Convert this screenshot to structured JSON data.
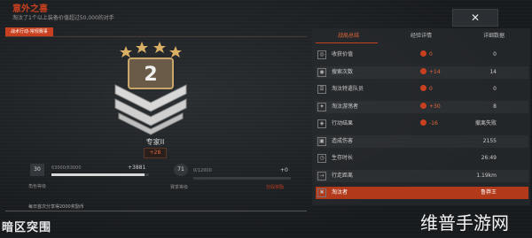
{
  "header": {
    "title": "意外之喜",
    "subtitle": "淘汰了1个以上装备价值超过50,000的对手",
    "topright": "",
    "back_label": "✕"
  },
  "tag": "战术行动-常规赛事",
  "rank": {
    "name": "专家II",
    "bonus": "+28",
    "emblem_number": "2",
    "stars": 4
  },
  "progress": {
    "left": {
      "level": "30",
      "exp": "63000/63000",
      "gain": "+3881",
      "label": "角色等级",
      "fill": 0.95
    },
    "right": {
      "level": "71",
      "exp": "0/12000",
      "gain": "+0",
      "label": "赛季等级",
      "note": "分段奖励",
      "fill": 0.0
    }
  },
  "footer": "每日首次分享得2000奖励币",
  "logo": "暗区突围",
  "watermark": "维普手游网",
  "stats": {
    "tabs": [
      "战局总结",
      "经验详情",
      "详细数据"
    ],
    "rows": [
      {
        "icon": "◎",
        "label": "收获价值",
        "mid": "0",
        "value": "0"
      },
      {
        "icon": "◉",
        "label": "搜索次数",
        "mid": "+14",
        "value": "14"
      },
      {
        "icon": "☰",
        "label": "淘汰特遣队员",
        "mid": "0",
        "value": "0"
      },
      {
        "icon": "✦",
        "label": "淘汰游荡者",
        "mid": "+30",
        "value": "8"
      },
      {
        "icon": "◈",
        "label": "行动结果",
        "mid": "-16",
        "value": "撤离失败"
      },
      {
        "icon": "▣",
        "label": "造成伤害",
        "mid": "",
        "value": "2155"
      },
      {
        "icon": "◷",
        "label": "生存时长",
        "mid": "",
        "value": "26:49"
      },
      {
        "icon": "⇢",
        "label": "行走距离",
        "mid": "",
        "value": "1.19km"
      },
      {
        "icon": "✖",
        "label": "淘汰者",
        "mid": "",
        "value": "鲁莽王"
      }
    ]
  },
  "colors": {
    "accent": "#c8401f",
    "bg": "#1a1d20"
  }
}
